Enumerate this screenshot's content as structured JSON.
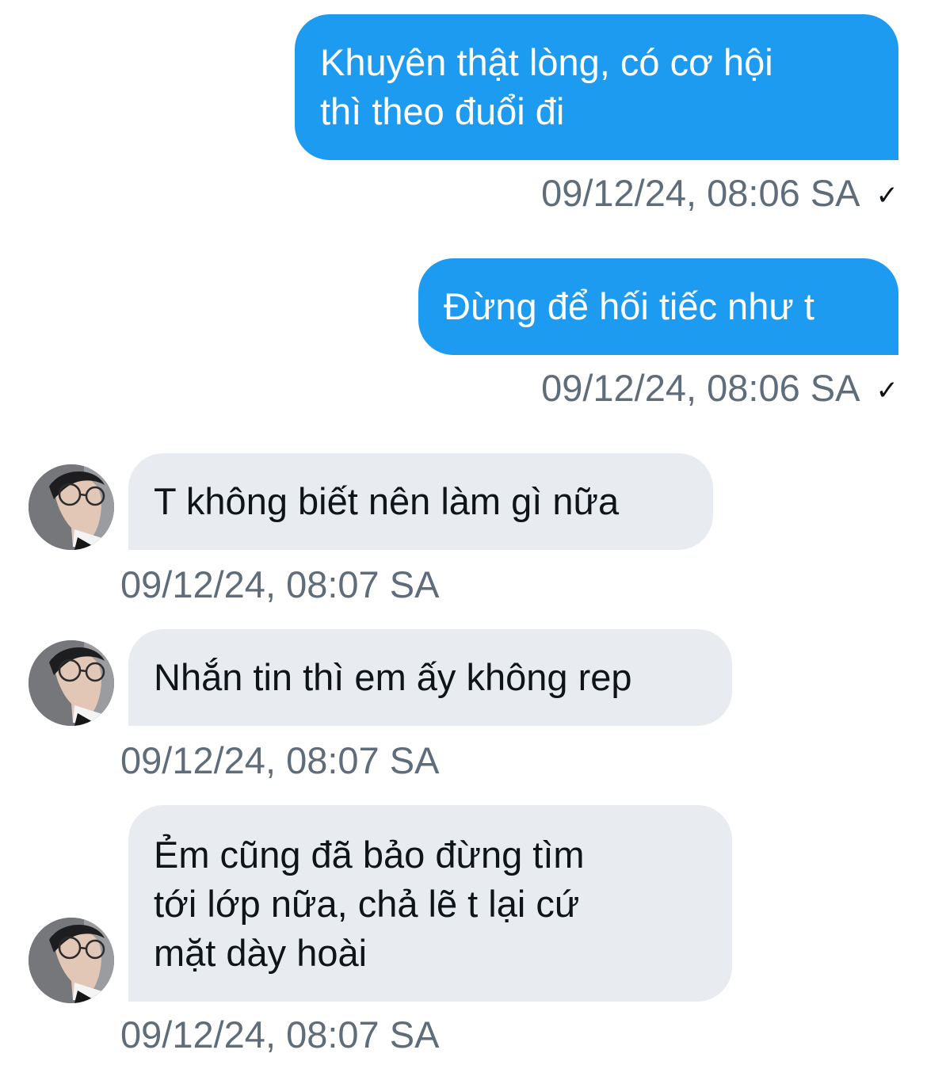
{
  "conversation": {
    "messages": [
      {
        "text": "Khuyên thật lòng, có cơ hội\nthì theo đuổi đi",
        "time": "09/12/24, 08:06 SA",
        "status_icon": "check-icon"
      },
      {
        "text": "Đừng để hối tiếc như t",
        "time": "09/12/24, 08:06 SA",
        "status_icon": "check-icon"
      },
      {
        "text": "T không biết nên làm gì nữa",
        "time": "09/12/24, 08:07 SA",
        "avatar_icon": "avatar"
      },
      {
        "text": "Nhắn tin thì em ấy không rep",
        "time": "09/12/24, 08:07 SA",
        "avatar_icon": "avatar"
      },
      {
        "text": "Ẻm cũng đã bảo đừng tìm\ntới lớp nữa, chả lẽ t lại cứ\nmặt dày hoài",
        "time": "09/12/24, 08:07 SA",
        "avatar_icon": "avatar"
      }
    ]
  },
  "colors": {
    "outgoing_bubble": "#1d9bf0",
    "incoming_bubble": "#e8ebef",
    "timestamp": "#5f6d7a"
  }
}
